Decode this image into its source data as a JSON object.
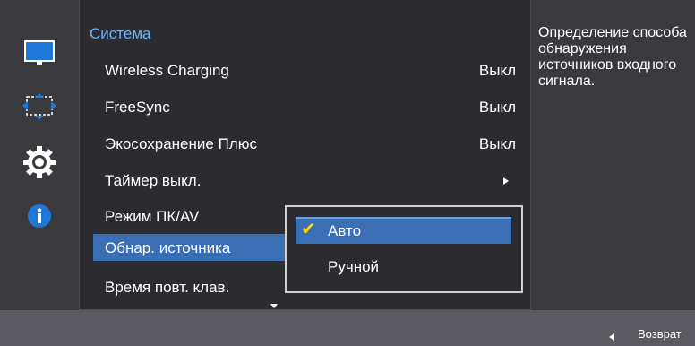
{
  "menu": {
    "title": "Система",
    "items": [
      {
        "label": "Wireless Charging",
        "value": "Выкл"
      },
      {
        "label": "FreeSync",
        "value": "Выкл"
      },
      {
        "label": "Экосохранение Плюс",
        "value": "Выкл"
      },
      {
        "label": "Таймер выкл.",
        "value": ""
      },
      {
        "label": "Режим ПК/AV",
        "value": ""
      },
      {
        "label": "Обнар. источника",
        "value": ""
      },
      {
        "label": "Время повт. клав.",
        "value": ""
      }
    ]
  },
  "submenu": {
    "options": [
      {
        "label": "Авто",
        "selected": true
      },
      {
        "label": "Ручной",
        "selected": false
      }
    ],
    "check_mark": "✔"
  },
  "info": {
    "description": "Определение способа обнаружения источников входного сигнала."
  },
  "footer": {
    "back_label": "Возврат"
  },
  "sidebar": {
    "icons": [
      "picture-icon",
      "onscreen-display-icon",
      "settings-gear-icon",
      "information-icon"
    ]
  },
  "colors": {
    "title_blue": "#6ab2ff",
    "highlight_blue": "#3a6fb6",
    "check_yellow": "#ffd800"
  }
}
